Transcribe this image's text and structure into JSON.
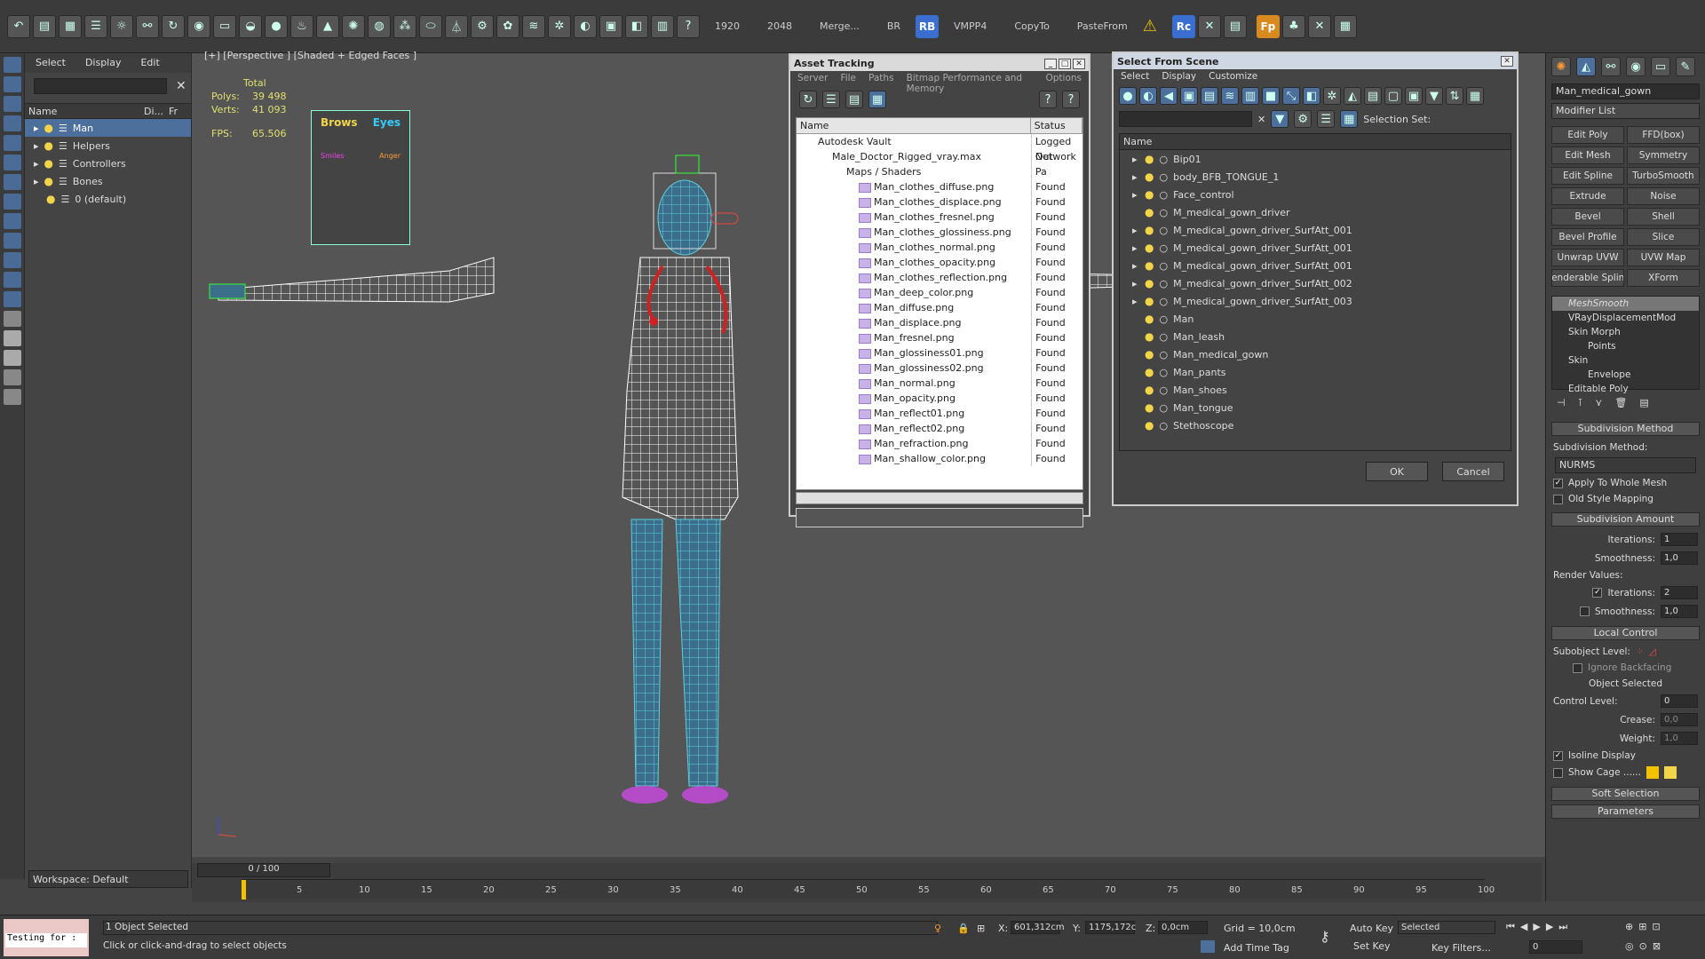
{
  "toolbar": {
    "texts": [
      "1920",
      "2048",
      "Merge...",
      "BR",
      "VMPP4",
      "CopyTo",
      "PasteFrom"
    ],
    "badges": [
      "RB",
      "Rc",
      "Fp"
    ]
  },
  "scene_explorer": {
    "menu": [
      "Select",
      "Display",
      "Edit"
    ],
    "columns": [
      "Name",
      "Di...",
      "Fr"
    ],
    "items": [
      {
        "label": "Man",
        "selected": true
      },
      {
        "label": "Helpers",
        "selected": false
      },
      {
        "label": "Controllers",
        "selected": false
      },
      {
        "label": "Bones",
        "selected": false
      },
      {
        "label": "0 (default)",
        "selected": false
      }
    ],
    "workspace": "Workspace: Default"
  },
  "viewport": {
    "label": "[+] [Perspective ] [Shaded + Edged Faces ]",
    "total_label": "Total",
    "polys_label": "Polys:",
    "polys": "39 498",
    "verts_label": "Verts:",
    "verts": "41 093",
    "fps_label": "FPS:",
    "fps": "65.506",
    "face_control": {
      "brows": "Brows",
      "eyes": "Eyes",
      "smiles": "Smiles",
      "anger": "Anger"
    }
  },
  "asset_tracking": {
    "title": "Asset Tracking",
    "menu": [
      "Server",
      "File",
      "Paths",
      "Bitmap Performance and Memory",
      "Options"
    ],
    "columns": [
      "Name",
      "Status"
    ],
    "rows": [
      {
        "name": "Autodesk Vault",
        "status": "Logged Out"
      },
      {
        "name": "Male_Doctor_Rigged_vray.max",
        "status": "Network Pa"
      },
      {
        "name": "Maps / Shaders",
        "status": ""
      },
      {
        "name": "Man_clothes_diffuse.png",
        "status": "Found"
      },
      {
        "name": "Man_clothes_displace.png",
        "status": "Found"
      },
      {
        "name": "Man_clothes_fresnel.png",
        "status": "Found"
      },
      {
        "name": "Man_clothes_glossiness.png",
        "status": "Found"
      },
      {
        "name": "Man_clothes_normal.png",
        "status": "Found"
      },
      {
        "name": "Man_clothes_opacity.png",
        "status": "Found"
      },
      {
        "name": "Man_clothes_reflection.png",
        "status": "Found"
      },
      {
        "name": "Man_deep_color.png",
        "status": "Found"
      },
      {
        "name": "Man_diffuse.png",
        "status": "Found"
      },
      {
        "name": "Man_displace.png",
        "status": "Found"
      },
      {
        "name": "Man_fresnel.png",
        "status": "Found"
      },
      {
        "name": "Man_glossiness01.png",
        "status": "Found"
      },
      {
        "name": "Man_glossiness02.png",
        "status": "Found"
      },
      {
        "name": "Man_normal.png",
        "status": "Found"
      },
      {
        "name": "Man_opacity.png",
        "status": "Found"
      },
      {
        "name": "Man_reflect01.png",
        "status": "Found"
      },
      {
        "name": "Man_reflect02.png",
        "status": "Found"
      },
      {
        "name": "Man_refraction.png",
        "status": "Found"
      },
      {
        "name": "Man_shallow_color.png",
        "status": "Found"
      }
    ]
  },
  "select_from_scene": {
    "title": "Select From Scene",
    "menu": [
      "Select",
      "Display",
      "Customize"
    ],
    "selection_set_label": "Selection Set:",
    "column": "Name",
    "items": [
      "Bip01",
      "body_BFB_TONGUE_1",
      "Face_control",
      "M_medical_gown_driver",
      "M_medical_gown_driver_SurfAtt_001",
      "M_medical_gown_driver_SurfAtt_001",
      "M_medical_gown_driver_SurfAtt_001",
      "M_medical_gown_driver_SurfAtt_002",
      "M_medical_gown_driver_SurfAtt_003",
      "Man",
      "Man_leash",
      "Man_medical_gown",
      "Man_pants",
      "Man_shoes",
      "Man_tongue",
      "Stethoscope"
    ],
    "ok": "OK",
    "cancel": "Cancel"
  },
  "command_panel": {
    "object_name": "Man_medical_gown",
    "modifier_list": "Modifier List",
    "buttons": [
      "Edit Poly",
      "FFD(box)",
      "Edit Mesh",
      "Symmetry",
      "Edit Spline",
      "TurboSmooth",
      "Extrude",
      "Noise",
      "Bevel",
      "Shell",
      "Bevel Profile",
      "Slice",
      "Unwrap UVW",
      "UVW Map",
      "Renderable Spline",
      "XForm"
    ],
    "stack": [
      "MeshSmooth",
      "VRayDisplacementMod",
      "Skin Morph",
      "Points",
      "Skin",
      "Envelope",
      "Editable Poly"
    ],
    "subdivision_method_title": "Subdivision Method",
    "subdivision_method_label": "Subdivision Method:",
    "subdivision_method_value": "NURMS",
    "apply_whole_mesh": "Apply To Whole Mesh",
    "old_style_mapping": "Old Style Mapping",
    "subdivision_amount_title": "Subdivision Amount",
    "iterations_label": "Iterations:",
    "iterations": "1",
    "smoothness_label": "Smoothness:",
    "smoothness": "1,0",
    "render_values": "Render Values:",
    "render_iterations": "2",
    "render_smoothness": "1,0",
    "local_control_title": "Local Control",
    "subobject_level": "Subobject Level:",
    "ignore_backfacing": "Ignore Backfacing",
    "object_selected": "Object Selected",
    "control_level_label": "Control Level:",
    "control_level": "0",
    "crease_label": "Crease:",
    "crease": "0,0",
    "weight_label": "Weight:",
    "weight": "1,0",
    "isoline_display": "Isoline Display",
    "show_cage": "Show Cage ......",
    "soft_selection": "Soft Selection",
    "parameters": "Parameters"
  },
  "timeline": {
    "frame_label": "0 / 100",
    "ticks": [
      "5",
      "10",
      "15",
      "20",
      "25",
      "30",
      "35",
      "40",
      "45",
      "50",
      "55",
      "60",
      "65",
      "70",
      "75",
      "80",
      "85",
      "90",
      "95",
      "100"
    ]
  },
  "status": {
    "script_input": "Testing for :",
    "selection": "1 Object Selected",
    "prompt": "Click or click-and-drag to select objects",
    "x_label": "X:",
    "x": "601,312cm",
    "y_label": "Y:",
    "y": "1175,172c",
    "z_label": "Z:",
    "z": "0,0cm",
    "grid": "Grid = 10,0cm",
    "add_time_tag": "Add Time Tag",
    "auto_key": "Auto Key",
    "set_key": "Set Key",
    "selected": "Selected",
    "key_filters": "Key Filters...",
    "frame": "0"
  },
  "colors": {
    "accent": "#4d6f9c",
    "wire": "#ffffff",
    "pants": "#5bd0e0",
    "yellow": "#f2d44b"
  }
}
